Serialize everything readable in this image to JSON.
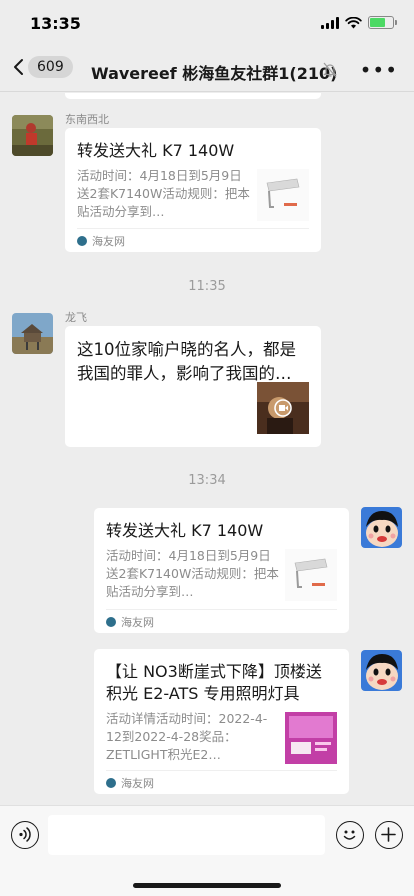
{
  "status": {
    "time": "13:35"
  },
  "nav": {
    "back_count": "609",
    "title": "Wavereef 彬海鱼友社群1(210)"
  },
  "timestamps": [
    "11:35",
    "13:34"
  ],
  "messages": [
    {
      "sender": "东南西北",
      "title": "转发送大礼 K7 140W",
      "desc": "活动时间：4月18日到5月9日送2套K7140W活动规则：把本贴活动分享到…",
      "source": "海友网"
    },
    {
      "sender": "龙飞",
      "text": "这10位家喻户晓的名人，都是我国的罪人，影响了我国的…"
    },
    {
      "title": "转发送大礼 K7 140W",
      "desc": "活动时间：4月18日到5月9日送2套K7140W活动规则：把本贴活动分享到…",
      "source": "海友网"
    },
    {
      "title": "【让 NO3断崖式下降】顶楼送积光 E2-ATS 专用照明灯具",
      "desc": "活动详情活动时间：2022-4-12到2022-4-28奖品：ZETLIGHT积光E2…",
      "source": "海友网"
    }
  ],
  "icons": [
    "signal-icon",
    "wifi-icon",
    "battery-icon",
    "back-chevron-icon",
    "mute-icon",
    "more-icon",
    "voice-icon",
    "emoji-icon",
    "plus-icon",
    "video-play-icon"
  ],
  "colors": {
    "background": "#ededed",
    "bubble": "#ffffff",
    "battery": "#4cd964"
  }
}
